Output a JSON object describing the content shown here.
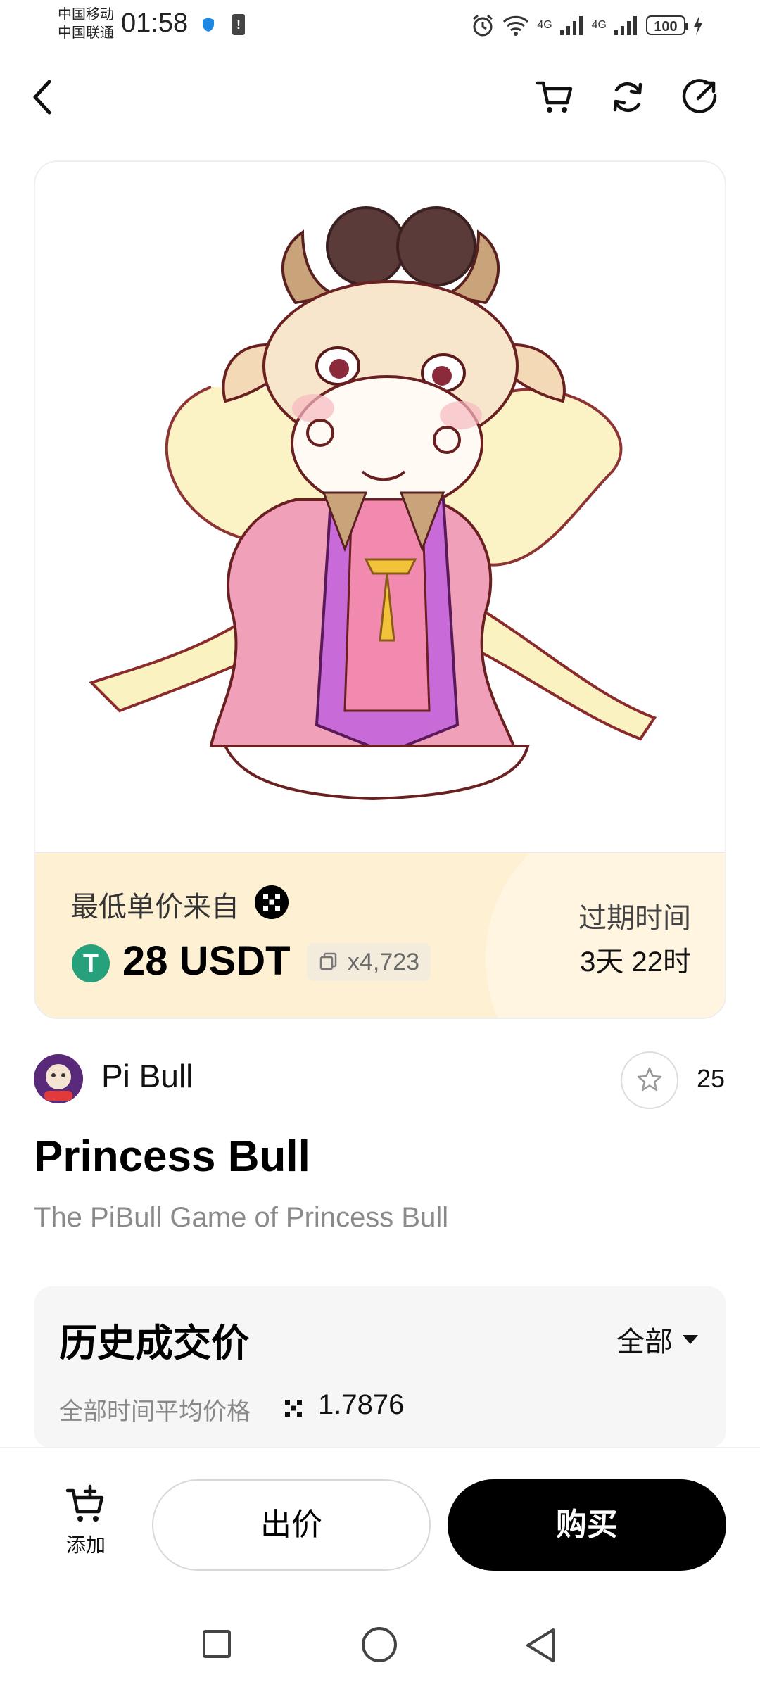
{
  "status_bar": {
    "carrier1": "中国移动",
    "carrier2": "中国联通",
    "time": "01:58",
    "network1": "4G",
    "network2": "4G",
    "battery": "100"
  },
  "nav": {
    "back_icon": "chevron-left-icon",
    "cart_icon": "cart-icon",
    "refresh_icon": "refresh-icon",
    "share_icon": "share-icon"
  },
  "price_panel": {
    "lowest_label": "最低单价来自",
    "price": "28 USDT",
    "token_symbol": "T",
    "quantity": "x4,723",
    "expire_label": "过期时间",
    "expire_value": "3天 22时"
  },
  "collection": {
    "name": "Pi Bull",
    "favorites": "25"
  },
  "nft": {
    "title": "Princess Bull",
    "description": "The PiBull Game of Princess Bull"
  },
  "history": {
    "title": "历史成交价",
    "filter": "全部",
    "avg_label": "全部时间平均价格",
    "avg_value": "1.7876"
  },
  "actions": {
    "add_label": "添加",
    "bid_label": "出价",
    "buy_label": "购买"
  },
  "colors": {
    "price_panel_bg": "#fdf0d3",
    "usdt_green": "#26a17b",
    "buy_button": "#000000"
  }
}
